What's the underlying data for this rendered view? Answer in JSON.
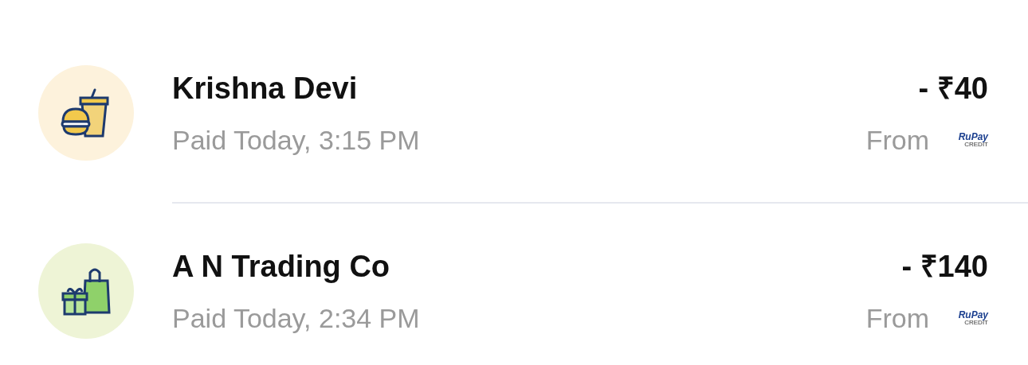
{
  "transactions": [
    {
      "kind": "food",
      "name": "Krishna Devi",
      "status": "Paid Today, 3:15 PM",
      "amount": "- ₹40",
      "from_label": "From",
      "card_brand": "RuPay",
      "card_type": "CREDIT"
    },
    {
      "kind": "shopping",
      "name": "A N Trading Co",
      "status": "Paid Today, 2:34 PM",
      "amount": "- ₹140",
      "from_label": "From",
      "card_brand": "RuPay",
      "card_type": "CREDIT"
    }
  ]
}
